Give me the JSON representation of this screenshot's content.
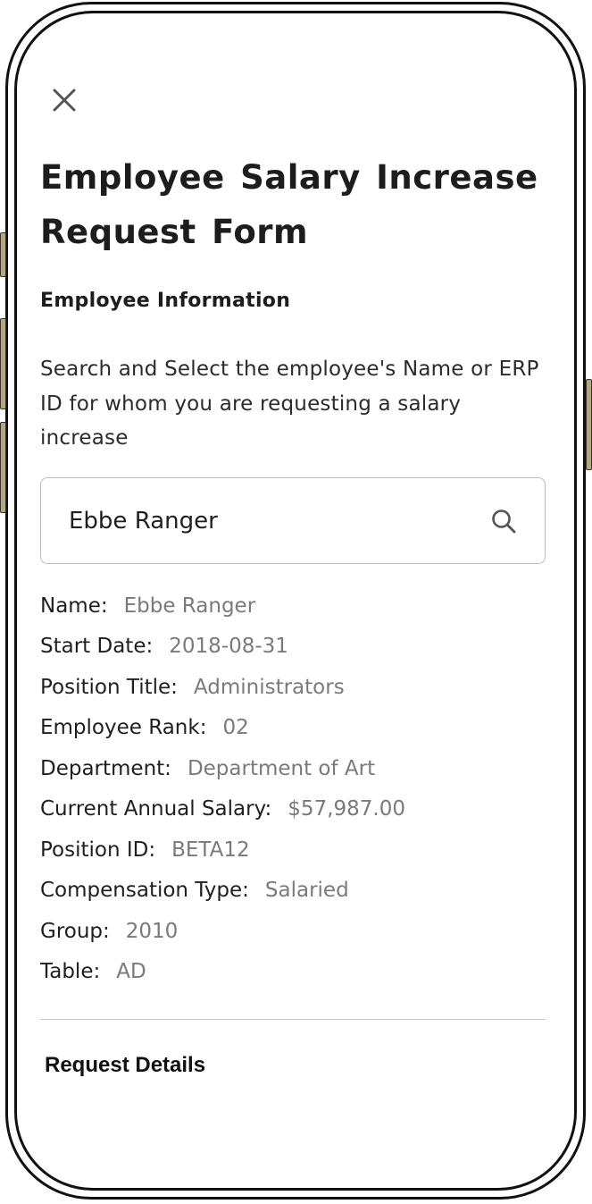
{
  "header": {
    "title": "Employee Salary Increase Request Form"
  },
  "employee_info": {
    "heading": "Employee Information",
    "instructions": "Search and Select the employee's Name or ERP ID for whom you are requesting a salary increase",
    "search": {
      "value": "Ebbe Ranger",
      "icon": "search-icon"
    },
    "fields": [
      {
        "label": "Name:",
        "value": "Ebbe Ranger"
      },
      {
        "label": "Start Date:",
        "value": "2018-08-31"
      },
      {
        "label": "Position Title:",
        "value": "Administrators"
      },
      {
        "label": "Employee Rank:",
        "value": "02"
      },
      {
        "label": "Department:",
        "value": "Department of Art"
      },
      {
        "label": "Current Annual Salary:",
        "value": "$57,987.00"
      },
      {
        "label": "Position ID:",
        "value": "BETA12"
      },
      {
        "label": "Compensation Type:",
        "value": "Salaried"
      },
      {
        "label": "Group:",
        "value": "2010"
      },
      {
        "label": "Table:",
        "value": "AD"
      }
    ]
  },
  "request_details": {
    "heading": "Request Details"
  },
  "colors": {
    "label_text": "#1f1f1f",
    "value_text": "#7a7a7a",
    "border": "#bdbdbd"
  }
}
